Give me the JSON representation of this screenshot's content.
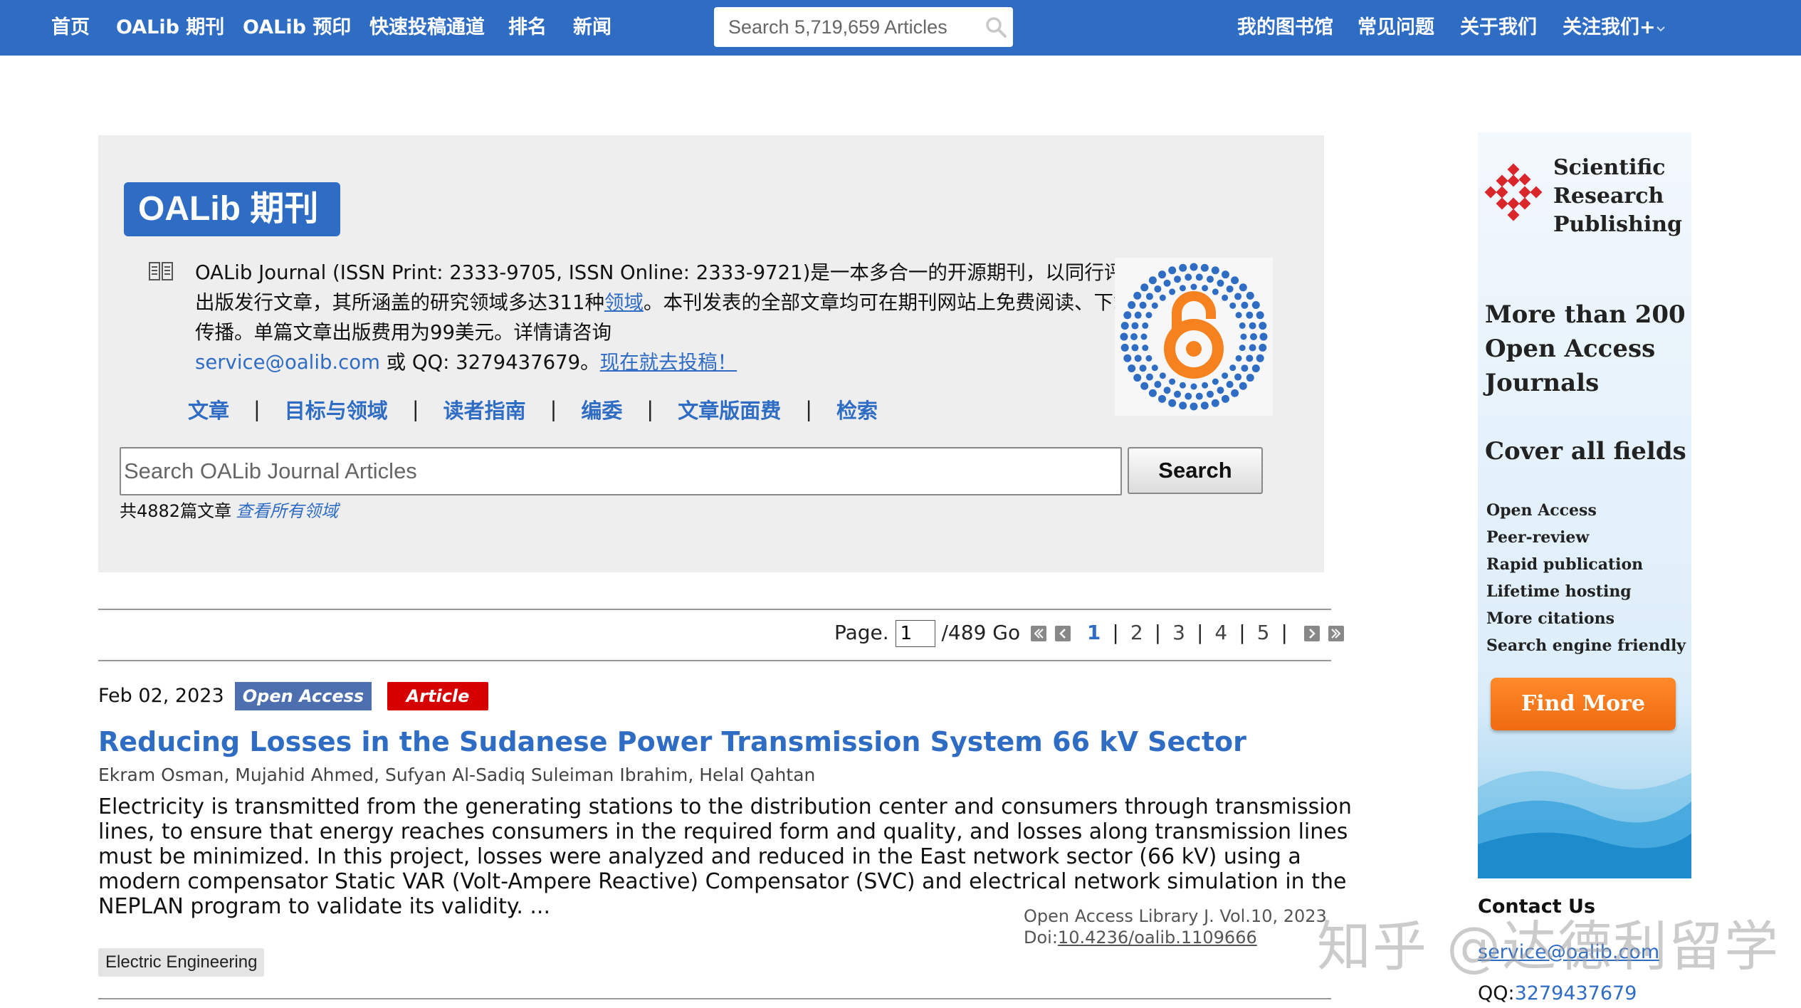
{
  "topnav": {
    "items_left": [
      {
        "label": "首页"
      },
      {
        "label": "OALib 期刊"
      },
      {
        "label": "OALib 预印"
      },
      {
        "label": "快速投稿通道"
      },
      {
        "label": "排名"
      },
      {
        "label": "新闻"
      }
    ],
    "search_placeholder": "Search 5,719,659 Articles",
    "items_right": [
      {
        "label": "我的图书馆"
      },
      {
        "label": "常见问题"
      },
      {
        "label": "关于我们"
      },
      {
        "label": "关注我们+"
      }
    ]
  },
  "journal": {
    "badge": "OALib 期刊",
    "desc_part1": "OALib Journal (ISSN Print: 2333-9705, ISSN Online: 2333-9721)是一本多合一的开源期刊，以同行评审的方式出版发行文章，其所涵盖的研究领域多达311种",
    "desc_link_fields": "领域",
    "desc_part2": "。本刊发表的全部文章均可在期刊网站上免费阅读、下载、引用和传播。单篇文章出版费用为99美元。详情请咨询",
    "desc_email": "service@oalib.com",
    "desc_part3": " 或 QQ: 3279437679。",
    "desc_submit": "现在就去投稿！",
    "links": [
      "文章",
      "目标与领域",
      "读者指南",
      "编委",
      "文章版面费",
      "检索"
    ],
    "search_placeholder": "Search OALib Journal Articles",
    "search_button": "Search",
    "count_text": "共4882篇文章",
    "all_fields_link": "查看所有领域"
  },
  "pager": {
    "page_label": "Page.",
    "current_value": "1",
    "total_text": "/489 Go",
    "pages": [
      "1",
      "2",
      "3",
      "4",
      "5"
    ]
  },
  "article": {
    "date": "Feb 02, 2023",
    "open_access_tag": "Open Access",
    "type_tag": "Article",
    "title": "Reducing Losses in the Sudanese Power Transmission System 66 kV Sector",
    "authors": "Ekram Osman, Mujahid Ahmed, Sufyan Al-Sadiq Suleiman Ibrahim, Helal Qahtan",
    "abstract_lines": [
      "Electricity is transmitted from the generating stations to the distribution center and consumers through transmission",
      "lines, to ensure that energy reaches consumers in the required form and quality, and losses along transmission lines",
      "must be minimized. In this project, losses were analyzed and reduced in the East network sector (66 kV) using a",
      "modern compensator Static VAR (Volt-Ampere Reactive) Compensator (SVC) and electrical network simulation in the",
      "NEPLAN program to validate its validity. ..."
    ],
    "journal_ref": "Open Access Library J.   Vol.10, 2023",
    "doi_label": "Doi:",
    "doi": "10.4236/oalib.1109666",
    "subject": "Electric Engineering"
  },
  "ad": {
    "publisher_lines": [
      "Scientific",
      "Research",
      "Publishing"
    ],
    "headline_lines": [
      "More than 200",
      "Open Access",
      "Journals"
    ],
    "subheadline": "Cover all fields",
    "features": [
      "Open Access",
      "Peer-review",
      "Rapid publication",
      "Lifetime hosting",
      "More citations",
      "Search engine friendly"
    ],
    "button": "Find More"
  },
  "contact": {
    "heading": "Contact Us",
    "email": "service@oalib.com",
    "qq_label": "QQ:",
    "qq": "3279437679"
  },
  "watermark": "知乎 @达德利留学",
  "colors": {
    "nav_blue": "#2f6cc4",
    "article_red": "#d70000",
    "ad_orange": "#f27a1a"
  }
}
